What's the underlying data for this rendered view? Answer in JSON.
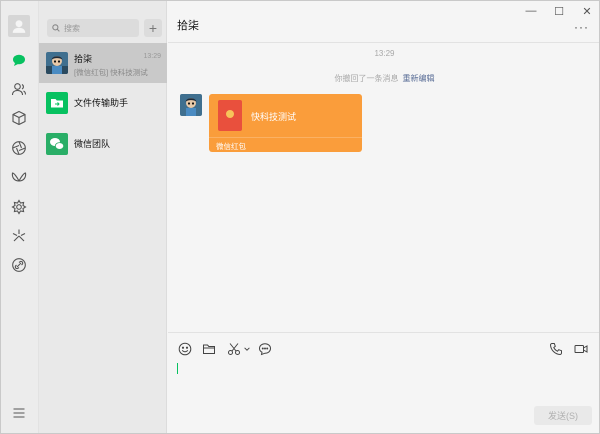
{
  "window": {
    "controls": {
      "minimize": "—",
      "maximize": "☐",
      "close": "✕"
    }
  },
  "nav": {
    "items": [
      {
        "id": "chats",
        "icon": "chat-bubble-icon",
        "active": true
      },
      {
        "id": "contacts",
        "icon": "contacts-icon"
      },
      {
        "id": "favorites",
        "icon": "cube-icon"
      },
      {
        "id": "moments",
        "icon": "aperture-icon"
      },
      {
        "id": "channels",
        "icon": "butterfly-icon"
      },
      {
        "id": "mini-programs",
        "icon": "gear-flower-icon"
      },
      {
        "id": "discover",
        "icon": "spark-icon"
      },
      {
        "id": "mini-apps",
        "icon": "link-circle-icon"
      }
    ],
    "menu_icon": "hamburger-icon"
  },
  "search": {
    "placeholder": "搜索",
    "add_label": "+"
  },
  "conversations": [
    {
      "name": "拾柒",
      "time": "13:29",
      "preview": "[微信红包] 快科技测试",
      "active": true
    },
    {
      "name": "文件传输助手",
      "time": "",
      "preview": ""
    },
    {
      "name": "微信团队",
      "time": "",
      "preview": ""
    }
  ],
  "chat": {
    "title": "拾柒",
    "more_label": "···",
    "timestamp": "13:29",
    "recall_text": "你撤回了一条消息",
    "recall_link": "重新编辑",
    "red_packet": {
      "title": "快科技测试",
      "footer": "微信红包"
    }
  },
  "input": {
    "tools": [
      "emoji-icon",
      "folder-icon",
      "scissors-icon",
      "chat-history-icon"
    ],
    "call_tools": [
      "phone-icon",
      "video-call-icon"
    ],
    "send_label": "发送(S)"
  },
  "colors": {
    "accent": "#07c160",
    "red_packet": "#fa9d3b",
    "link": "#576b95"
  }
}
